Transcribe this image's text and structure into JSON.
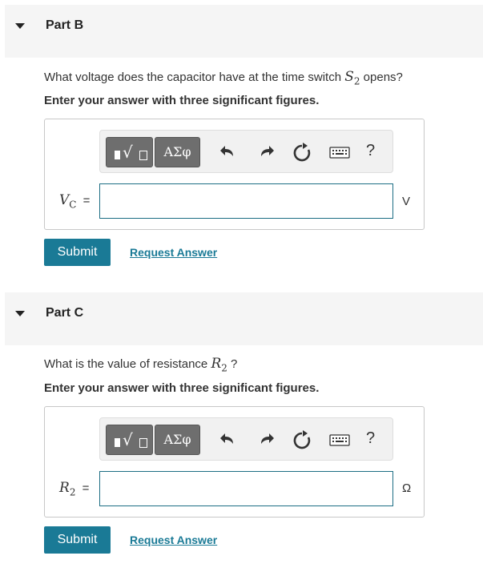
{
  "part_b": {
    "title": "Part B",
    "question_pre": "What voltage does the capacitor have at the time switch ",
    "question_var": "S",
    "question_var_sub": "2",
    "question_post": " opens?",
    "instruction": "Enter your answer with three significant figures.",
    "variable": "V",
    "variable_sub": "C",
    "equals": "=",
    "input_value": "",
    "unit": "V",
    "submit_label": "Submit",
    "request_label": "Request Answer"
  },
  "part_c": {
    "title": "Part C",
    "question_pre": "What is the value of resistance ",
    "question_var": "R",
    "question_var_sub": "2",
    "question_post": " ?",
    "instruction": "Enter your answer with three significant figures.",
    "variable": "R",
    "variable_sub": "2",
    "equals": "=",
    "input_value": "",
    "unit": "Ω",
    "submit_label": "Submit",
    "request_label": "Request Answer"
  },
  "toolbar": {
    "symbols_label": "ΑΣφ",
    "help_label": "?",
    "icons": [
      "templates-icon",
      "undo-icon",
      "redo-icon",
      "reset-icon",
      "keyboard-icon",
      "help-icon"
    ]
  },
  "colors": {
    "accent": "#1a7a96",
    "header_bg": "#f5f5f5",
    "toolbar_btn": "#6e6e6e"
  }
}
